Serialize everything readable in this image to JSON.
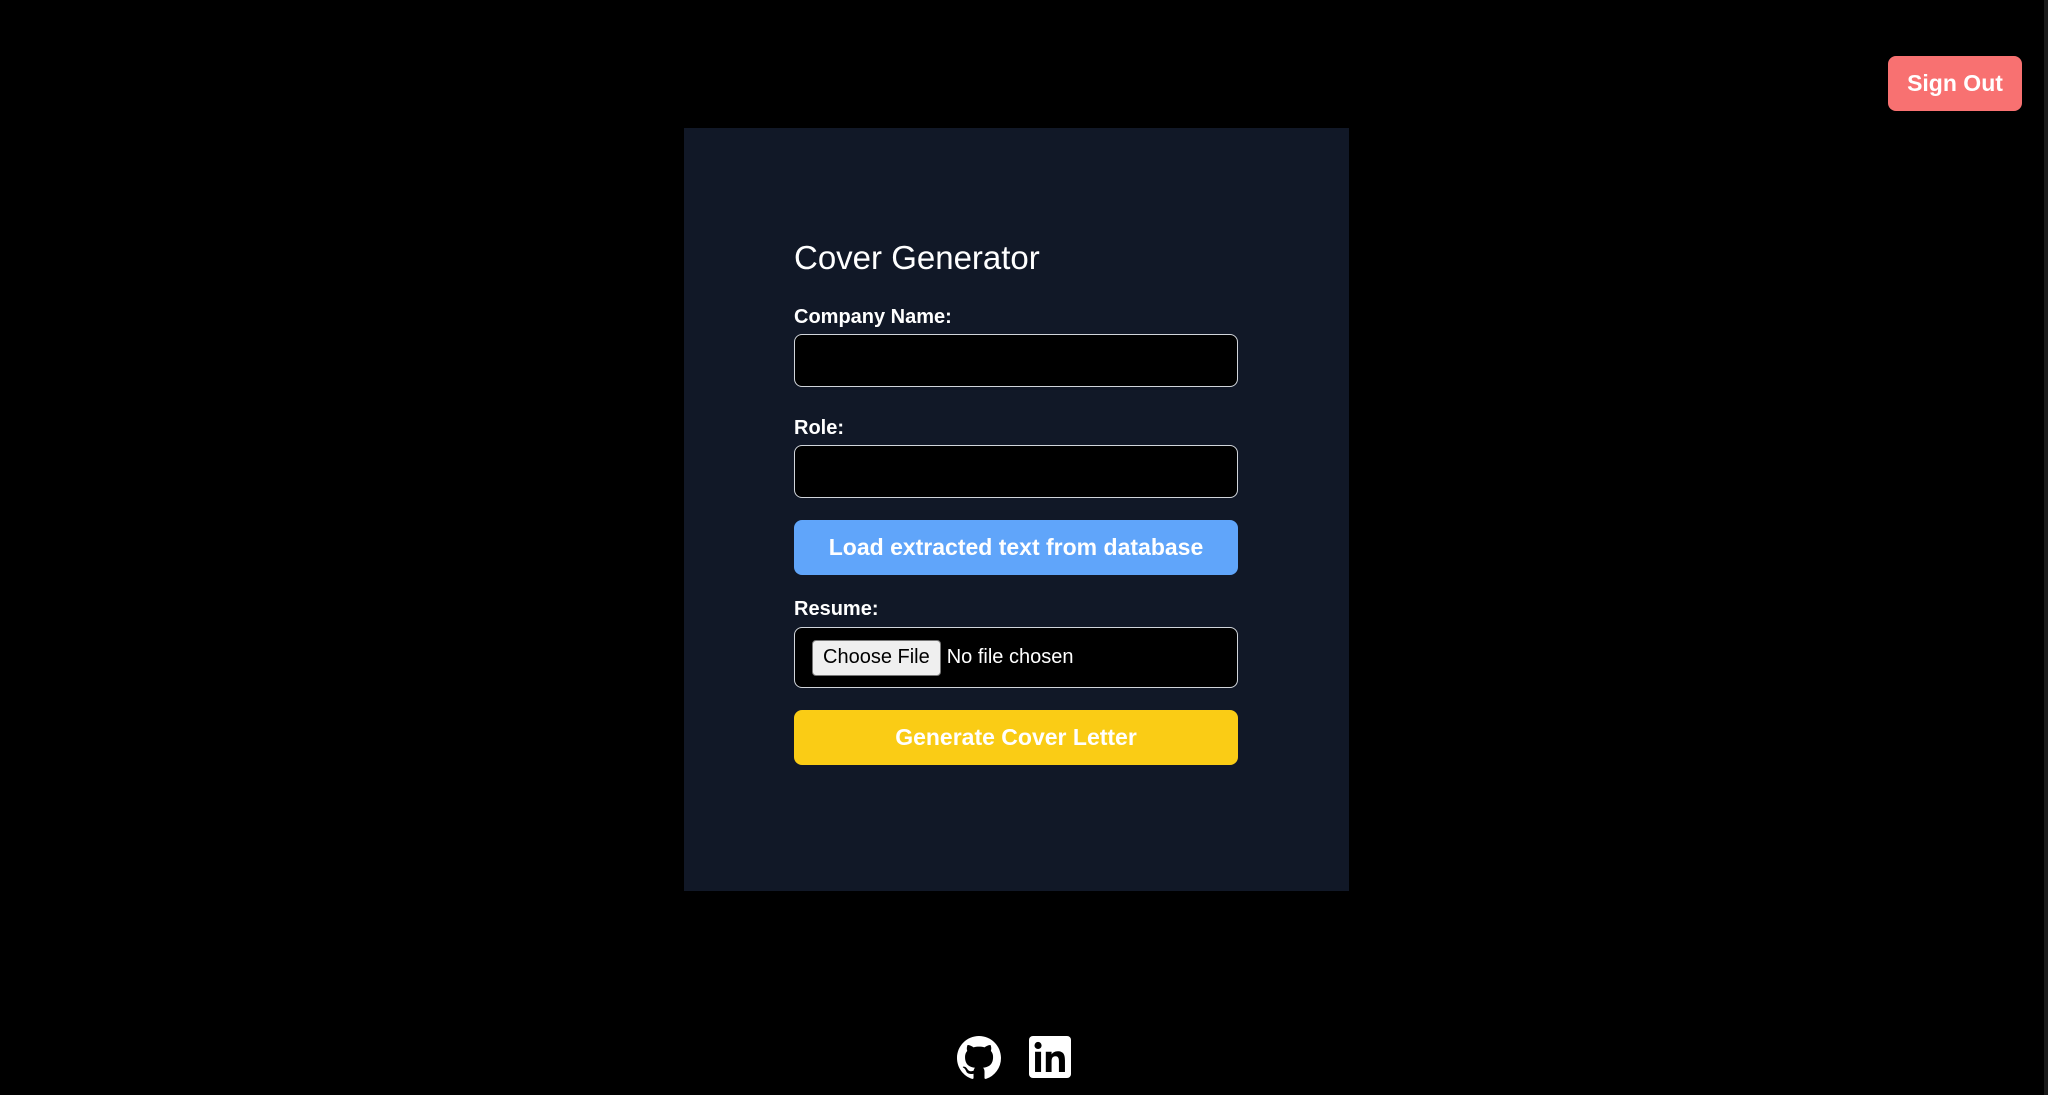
{
  "header": {
    "sign_out_label": "Sign Out"
  },
  "form": {
    "title": "Cover Generator",
    "company_label": "Company Name:",
    "company_value": "",
    "role_label": "Role:",
    "role_value": "",
    "load_button_label": "Load extracted text from database",
    "resume_label": "Resume:",
    "choose_file_label": "Choose File",
    "file_status": "No file chosen",
    "generate_button_label": "Generate Cover Letter"
  },
  "footer": {
    "icons": [
      "github-icon",
      "linkedin-icon"
    ]
  },
  "colors": {
    "page_bg": "#000000",
    "card_bg": "#111827",
    "sign_out_bg": "#f87171",
    "load_button_bg": "#60a5fa",
    "generate_button_bg": "#facc15"
  }
}
